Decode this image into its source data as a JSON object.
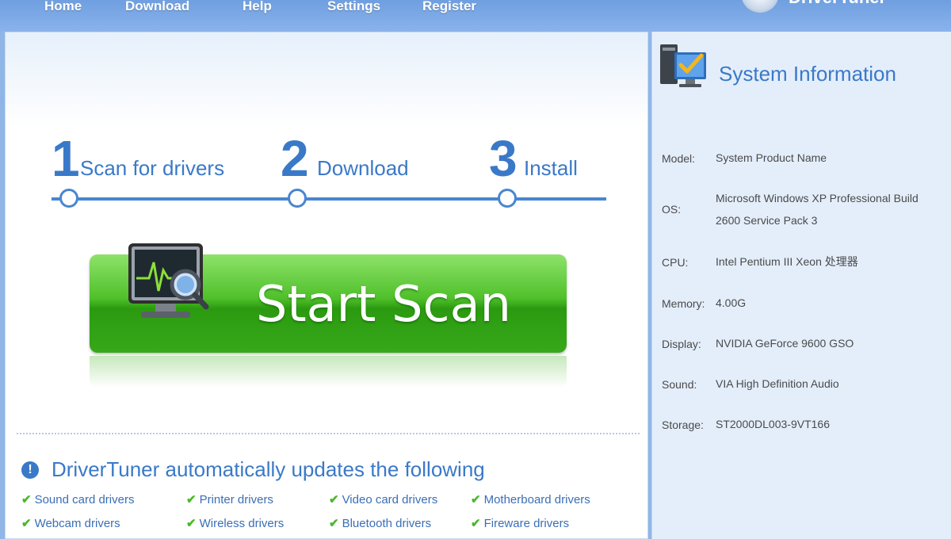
{
  "nav": {
    "items": [
      "Home",
      "Download",
      "Help",
      "Settings",
      "Register"
    ],
    "brand": "DriverTuner"
  },
  "steps": [
    {
      "num": "1",
      "label": "Scan for drivers"
    },
    {
      "num": "2",
      "label": "Download"
    },
    {
      "num": "3",
      "label": "Install"
    }
  ],
  "scan": {
    "label": "Start Scan"
  },
  "updates": {
    "title": "DriverTuner automatically updates the following",
    "features": [
      "Sound card drivers",
      "Printer drivers",
      "Video card drivers",
      "Motherboard drivers",
      "Webcam drivers",
      "Wireless drivers",
      "Bluetooth drivers",
      "Fireware drivers"
    ]
  },
  "system": {
    "title": "System Information",
    "rows": [
      {
        "label": "Model:",
        "value": "System Product Name"
      },
      {
        "label": "OS:",
        "value": "Microsoft Windows XP Professional Build 2600 Service Pack 3"
      },
      {
        "label": "CPU:",
        "value": "Intel Pentium III Xeon 处理器"
      },
      {
        "label": "Memory:",
        "value": "4.00G"
      },
      {
        "label": "Display:",
        "value": "NVIDIA GeForce 9600 GSO"
      },
      {
        "label": "Sound:",
        "value": "VIA High Definition Audio"
      },
      {
        "label": "Storage:",
        "value": "ST2000DL003-9VT166"
      }
    ]
  },
  "colors": {
    "accent": "#3a79c8",
    "scan_green": "#3fb01c",
    "check_green": "#48b82a",
    "nav_bg": "#7aa8e6"
  }
}
